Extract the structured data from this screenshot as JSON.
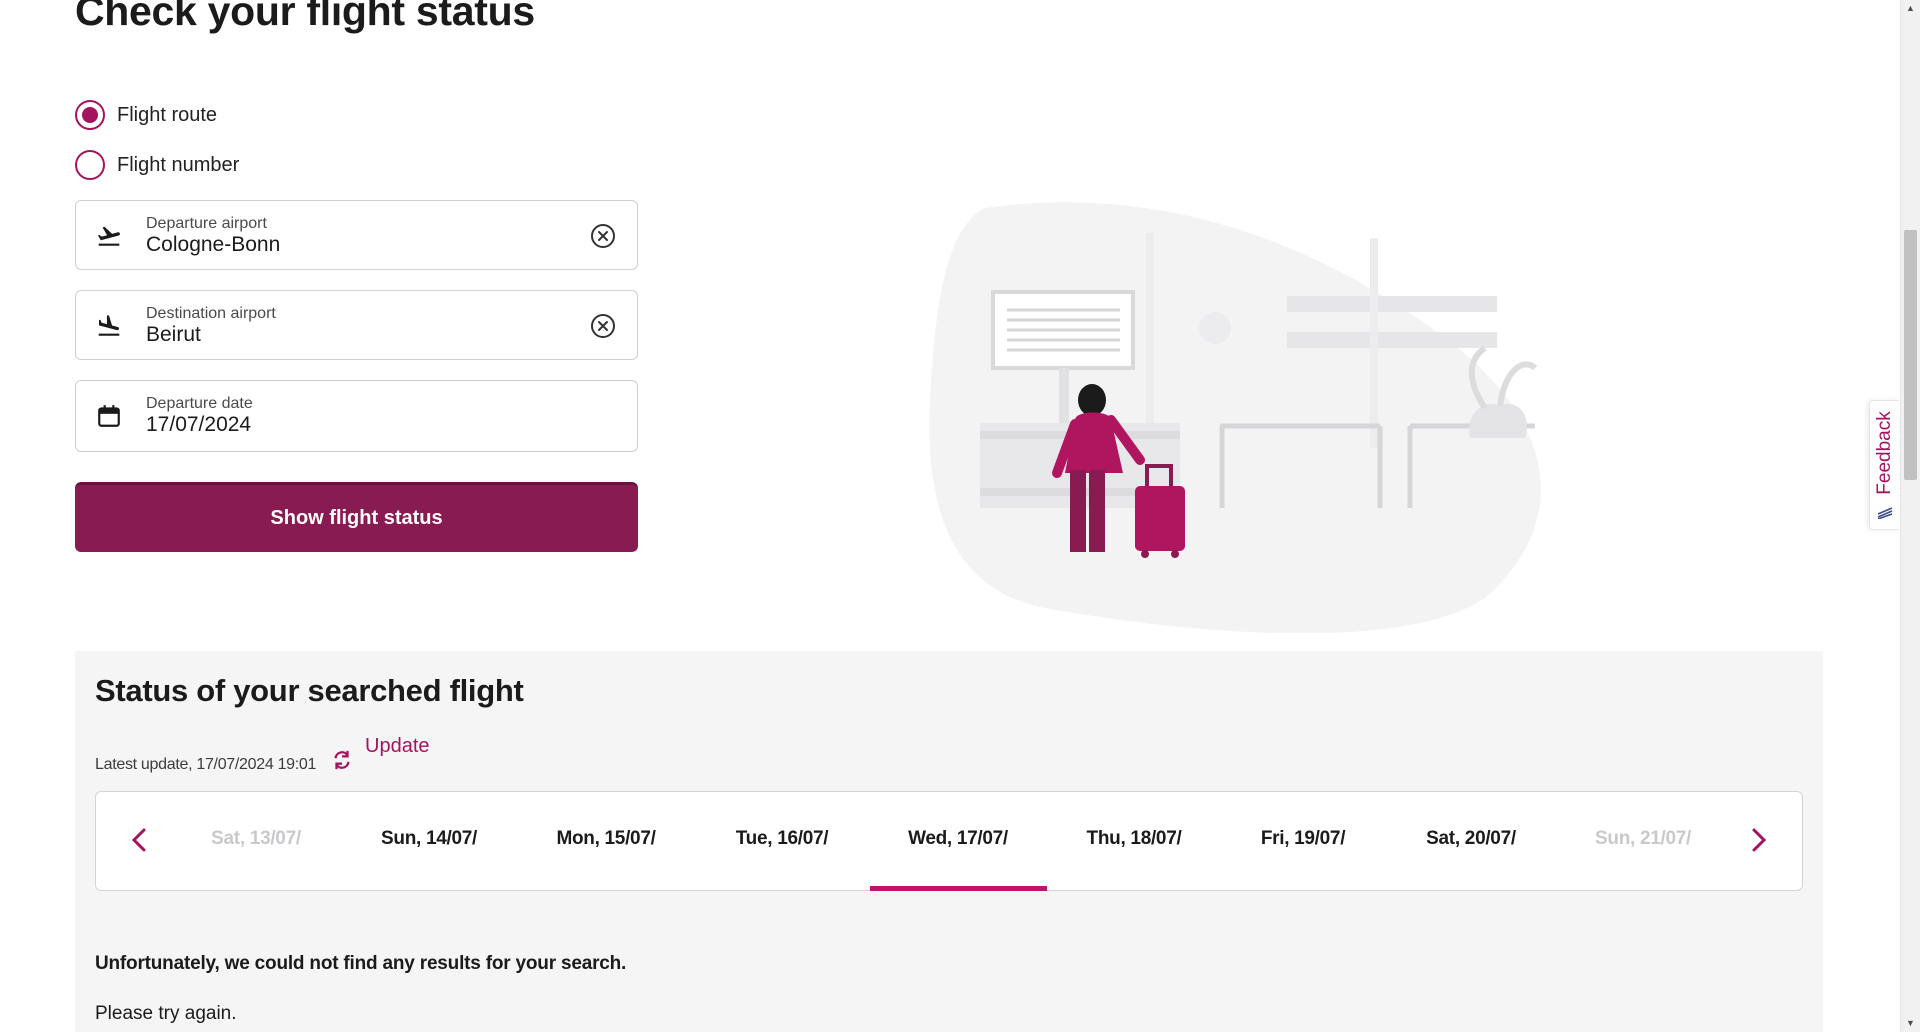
{
  "page": {
    "title": "Check your flight status"
  },
  "search_mode": {
    "options": [
      {
        "label": "Flight route",
        "selected": true
      },
      {
        "label": "Flight number",
        "selected": false
      }
    ]
  },
  "form": {
    "departure": {
      "label": "Departure airport",
      "value": "Cologne-Bonn",
      "icon": "plane-takeoff-icon"
    },
    "destination": {
      "label": "Destination airport",
      "value": "Beirut",
      "icon": "plane-landing-icon"
    },
    "date": {
      "label": "Departure date",
      "value": "17/07/2024",
      "icon": "calendar-icon"
    },
    "submit_label": "Show flight status"
  },
  "status": {
    "title": "Status of your searched flight",
    "latest_update": "Latest update, 17/07/2024 19:01",
    "update_label": "Update",
    "dates": [
      {
        "label": "Sat, 13/07/",
        "disabled": true
      },
      {
        "label": "Sun, 14/07/",
        "disabled": false
      },
      {
        "label": "Mon, 15/07/",
        "disabled": false
      },
      {
        "label": "Tue, 16/07/",
        "disabled": false
      },
      {
        "label": "Wed, 17/07/",
        "disabled": false,
        "selected": true
      },
      {
        "label": "Thu, 18/07/",
        "disabled": false
      },
      {
        "label": "Fri, 19/07/",
        "disabled": false
      },
      {
        "label": "Sat, 20/07/",
        "disabled": false
      },
      {
        "label": "Sun, 21/07/",
        "disabled": true
      }
    ],
    "no_results": "Unfortunately, we could not find any results for your search.",
    "try_again": "Please try again."
  },
  "feedback": {
    "label": "Feedback"
  },
  "colors": {
    "accent": "#a5135f",
    "button": "#891b53",
    "underline": "#c2136a"
  }
}
